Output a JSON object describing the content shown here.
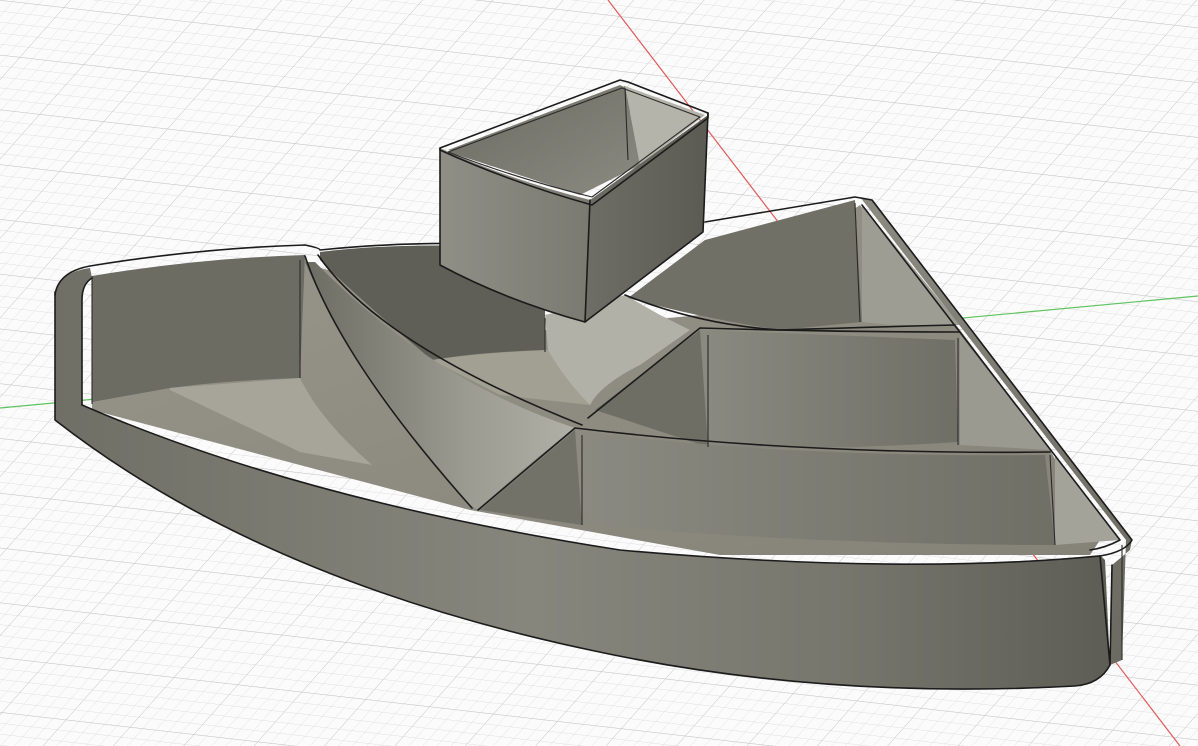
{
  "viewport": {
    "background": "#fbfbfb",
    "grid_color": "#d6d6d6",
    "grid_major_color": "#c2c2c2",
    "x_axis_color": "#e05a5a",
    "y_axis_color": "#5ec45e"
  },
  "model": {
    "body_color": "#7d7d72",
    "body_dark_color": "#5e5e55",
    "body_light_color": "#a7a79e",
    "floor_color": "#8f8d82",
    "edge_color": "#1b1b1b",
    "parts": [
      "corner-organizer-tray",
      "insert-bin"
    ]
  }
}
